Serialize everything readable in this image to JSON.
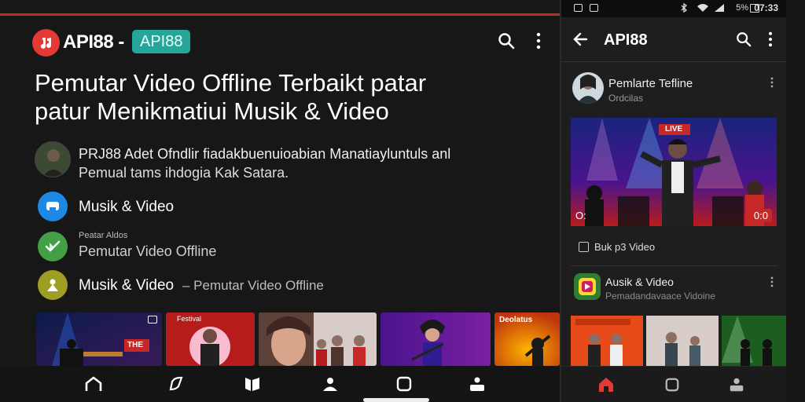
{
  "app": {
    "logo_text": "API88 -",
    "badge": "API88",
    "headline_line1": "Pemutar Video Offline Terbaikt patar",
    "headline_line2": "patur Menikmatiui Musik & Video"
  },
  "featured": {
    "line1": "PRJ88 Adet Ofndlir fiadakbuenuioabian Manatiayluntuls anl",
    "line2": "Pemual tams ihdogia Kak Satara."
  },
  "categories": [
    {
      "label": "Musik & Video",
      "icon": "tv-icon",
      "color": "#1e88e5"
    },
    {
      "small": "Peatar Aldos",
      "label": "Pemutar Video Offline",
      "icon": "check-play-icon",
      "color": "#43a047"
    },
    {
      "label": "Musik & Video",
      "sub": "– Pemutar Video Offline",
      "icon": "user-icon",
      "color": "#9e9d24"
    }
  ],
  "thumb_overlays": [
    "THE",
    "Festival",
    "Deolatus"
  ],
  "phone": {
    "status_pct": "5%",
    "status_time": "07:33",
    "title": "API88",
    "channel_title": "Pemlarte Tefline",
    "channel_sub": "Ordcilas",
    "video_left": "O:",
    "video_badge": "0:0",
    "video_banner": "LIVE",
    "checkbox_label": "Buk p3 Video",
    "app_title": "Ausik & Video",
    "app_sub": "Pemadandavaace Vidoine"
  },
  "colors": {
    "accent_red": "#e53935",
    "badge_teal": "#26a69a",
    "background": "#171717"
  }
}
